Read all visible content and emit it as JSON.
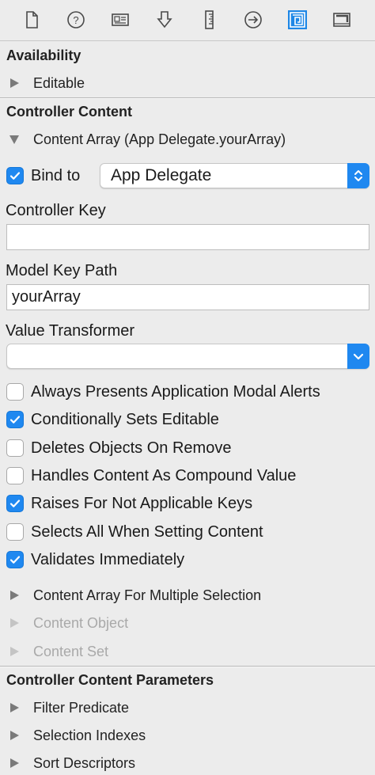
{
  "toolbar": {
    "icons": [
      "file-inspector-icon",
      "quick-help-icon",
      "identity-inspector-icon",
      "attributes-inspector-icon",
      "size-inspector-icon",
      "connections-inspector-icon",
      "bindings-inspector-icon",
      "view-effects-inspector-icon"
    ],
    "active_icon": "bindings-inspector-icon",
    "accent_color": "#1e87e6"
  },
  "availability": {
    "heading": "Availability",
    "items": [
      {
        "label": "Editable",
        "expanded": false
      }
    ]
  },
  "controller_content": {
    "heading": "Controller Content",
    "content_array": {
      "label": "Content Array (App Delegate.yourArray)",
      "expanded": true,
      "bind_to": {
        "label": "Bind to",
        "checked": true,
        "value": "App Delegate"
      },
      "controller_key": {
        "label": "Controller Key",
        "value": ""
      },
      "model_key_path": {
        "label": "Model Key Path",
        "value": "yourArray"
      },
      "value_transformer": {
        "label": "Value Transformer",
        "value": ""
      },
      "options": [
        {
          "label": "Always Presents Application Modal Alerts",
          "checked": false
        },
        {
          "label": "Conditionally Sets Editable",
          "checked": true
        },
        {
          "label": "Deletes Objects On Remove",
          "checked": false
        },
        {
          "label": "Handles Content As Compound Value",
          "checked": false
        },
        {
          "label": "Raises For Not Applicable Keys",
          "checked": true
        },
        {
          "label": "Selects All When Setting Content",
          "checked": false
        },
        {
          "label": "Validates Immediately",
          "checked": true
        }
      ]
    },
    "more": [
      {
        "label": "Content Array For Multiple Selection",
        "enabled": true
      },
      {
        "label": "Content Object",
        "enabled": false
      },
      {
        "label": "Content Set",
        "enabled": false
      }
    ]
  },
  "controller_content_parameters": {
    "heading": "Controller Content Parameters",
    "items": [
      {
        "label": "Filter Predicate"
      },
      {
        "label": "Selection Indexes"
      },
      {
        "label": "Sort Descriptors"
      }
    ]
  }
}
